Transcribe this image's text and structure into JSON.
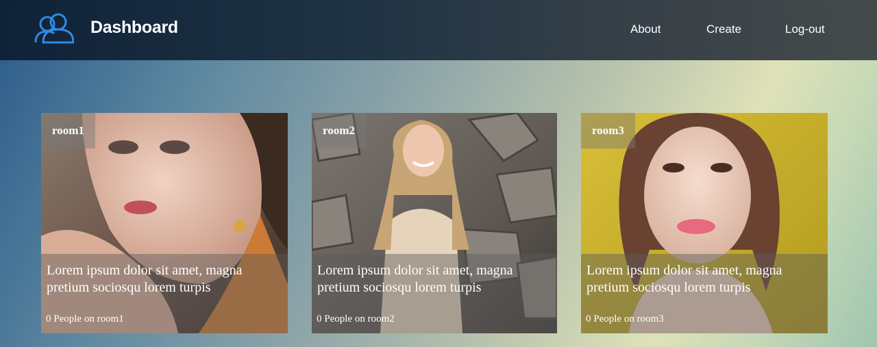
{
  "header": {
    "logo_icon": "users-icon",
    "title": "Dashboard",
    "nav": {
      "about": "About",
      "create": "Create",
      "logout": "Log-out"
    }
  },
  "rooms": [
    {
      "name": "room1",
      "description": "Lorem ipsum dolor sit amet, magna pretium sociosqu lorem turpis",
      "people": "0 People on room1"
    },
    {
      "name": "room2",
      "description": "Lorem ipsum dolor sit amet, magna pretium sociosqu lorem turpis",
      "people": "0 People on room2"
    },
    {
      "name": "room3",
      "description": "Lorem ipsum dolor sit amet, magna pretium sociosqu lorem turpis",
      "people": "0 People on room3"
    }
  ],
  "colors": {
    "accent": "#2f8be0",
    "text": "#ffffff"
  }
}
